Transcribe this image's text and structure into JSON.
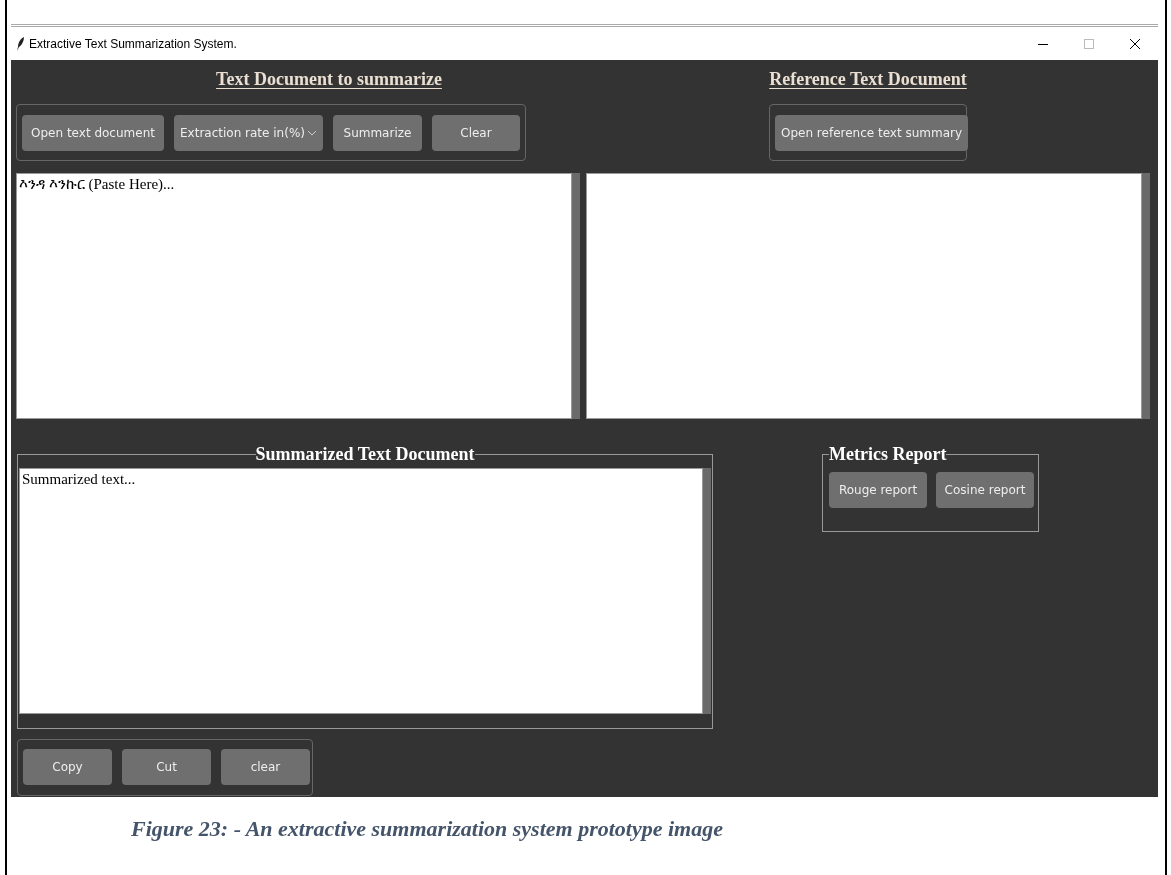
{
  "window": {
    "title": "Extractive Text Summarization System."
  },
  "source_panel": {
    "heading": "Text Document to summarize",
    "buttons": [
      {
        "kind": "button",
        "label": "Open text document"
      },
      {
        "kind": "dropdown",
        "label": "Extraction rate in(%)"
      },
      {
        "kind": "button",
        "label": "Summarize"
      },
      {
        "kind": "button",
        "label": "Clear"
      }
    ],
    "text_area": {
      "value": "እንዳ እንኩር (Paste Here)..."
    }
  },
  "reference_panel": {
    "heading": "Reference Text Document",
    "buttons": [
      {
        "kind": "button",
        "label": "Open reference text summary"
      }
    ]
  },
  "summary_panel": {
    "title": "Summarized Text Document",
    "text_area": {
      "value": "Summarized text..."
    },
    "buttons": [
      {
        "kind": "button",
        "label": "Copy"
      },
      {
        "kind": "button",
        "label": "Cut"
      },
      {
        "kind": "button",
        "label": "clear"
      }
    ]
  },
  "metrics_panel": {
    "title": "Metrics Report",
    "buttons": [
      {
        "kind": "button",
        "label": "Rouge report"
      },
      {
        "kind": "button",
        "label": "Cosine report"
      }
    ]
  },
  "caption": "Figure 23: - An extractive summarization system prototype image"
}
